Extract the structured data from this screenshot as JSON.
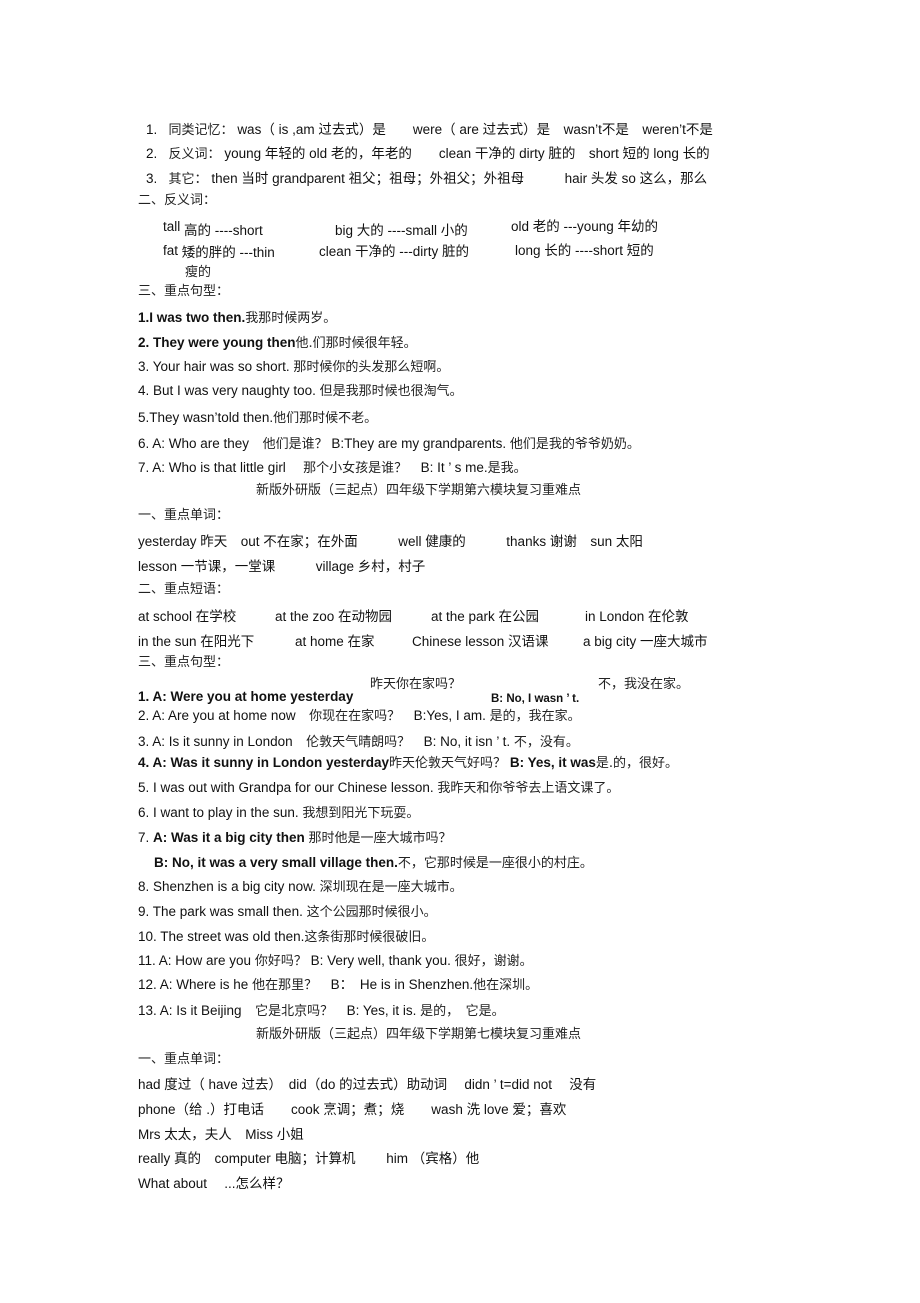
{
  "module5": {
    "memory_lines": [
      {
        "num": "1.",
        "label": "同类记忆：",
        "text": "was（ is ,am 过去式）是　　were（ are 过去式）是　wasn’t不是　weren’t不是"
      },
      {
        "num": "2.",
        "label": "反义词：",
        "text": "young 年轻的  old 老的，年老的　　clean 干净的  dirty 脏的　short 短的 long 长的"
      },
      {
        "num": "3.",
        "label": "其它：",
        "text": "then 当时  grandparent 祖父；祖母；外祖父；外祖母　　　hair 头发  so 这么，那么"
      }
    ],
    "antonyms_heading": "二、反义词：",
    "antonyms": [
      {
        "word": "tall",
        "rest": "高的 ----short"
      },
      {
        "word": "big",
        "rest": "大的 ----small  小的"
      },
      {
        "word": "old",
        "rest": "老的 ---young 年幼的"
      },
      {
        "word": "fat",
        "rest": "矮的胖的 ---thin"
      },
      {
        "word": "clean",
        "rest": "干净的 ---dirty  脏的"
      },
      {
        "word": "long",
        "rest": "长的 ----short 短的"
      },
      {
        "word": "",
        "rest": "瘦的"
      }
    ],
    "sentences_heading": "三、重点句型：",
    "sentences": [
      {
        "en": "1.I was two then.",
        "cn": "我那时候两岁。",
        "bold": true
      },
      {
        "en": "2. They were young then",
        "cn": "他.们那时候很年轻。",
        "bold": true
      },
      {
        "en": "3. Your hair was so short. ",
        "cn": "那时候你的头发那么短啊。",
        "bold": false
      },
      {
        "en": "4. But I was very naughty too. ",
        "cn": "但是我那时候也很淘气。",
        "bold": false
      },
      {
        "en": "5.They wasn’told then.",
        "cn": "他们那时候不老。",
        "bold": false
      },
      {
        "en": "6. A: Who are they　",
        "cn": "他们是谁？",
        "en2": " B:They are my grandparents. ",
        "cn2": "他们是我的爷爷奶奶。",
        "bold": false
      },
      {
        "en": "7. A: Who is that little girl　 ",
        "cn": "那个小女孩是谁？",
        "en2": "　B: It ’ s me.",
        "cn2": "是我。",
        "bold": false
      }
    ]
  },
  "module6": {
    "title": "新版外研版（三起点）四年级下学期第六模块复习重难点",
    "words_heading": "一、重点单词：",
    "word_lines": [
      "yesterday 昨天　out 不在家；在外面　　　well 健康的　　　thanks 谢谢　sun 太阳",
      "lesson 一节课，一堂课　　　village 乡村，村子"
    ],
    "phrases_heading": "二、重点短语：",
    "phrase_lines": [
      [
        "at school 在学校",
        "at the zoo 在动物园",
        "at the park 在公园",
        "in London 在伦敦"
      ],
      [
        "in the sun 在阳光下",
        "at home 在家",
        "Chinese lesson 汉语课",
        "a big city 一座大城市"
      ]
    ],
    "sentences_heading": "三、重点句型：",
    "s1": {
      "en": "1. A: Were you at home yesterday",
      "cn": "昨天你在家吗？",
      "b_en": "B: No, I wasn ’ t.",
      "b_cn": "不，我没在家。"
    },
    "s2": {
      "en": "2. A: Are you at home now　",
      "cn": "你现在在家吗？",
      "en2": "　B:Yes, I am. ",
      "cn2": "是的，我在家。"
    },
    "s3": {
      "en": "3. A: Is it sunny in London　",
      "cn": "伦敦天气晴朗吗？",
      "en2": "　B: No, it isn ’ t. ",
      "cn2": "不，没有。"
    },
    "s4": {
      "en": "4. A: Was it sunny in London yesterday",
      "cn": "昨天伦敦天气好吗？",
      "en2": " B: Yes, it was",
      "cn2": "是.的，很好。"
    },
    "s5": {
      "en": "5. I was out with Grandpa for our Chinese lesson. ",
      "cn": "我昨天和你爷爷去上语文课了。"
    },
    "s6": {
      "en": "6. I want to play in the sun. ",
      "cn": "我想到阳光下玩耍。"
    },
    "s7a": {
      "num": "7. ",
      "en": "A: Was it a big city then ",
      "cn": "那时他是一座大城市吗？"
    },
    "s7b": {
      "en": "B: No, it was a very small village then.",
      "cn": "不，它那时候是一座很小的村庄。"
    },
    "s8": {
      "en": "8. Shenzhen is a big city now. ",
      "cn": "深圳现在是一座大城市。"
    },
    "s9": {
      "en": "9. The park was small then. ",
      "cn": "这个公园那时候很小。"
    },
    "s10": {
      "en": "10. The street was old then.",
      "cn": "这条街那时候很破旧。"
    },
    "s11": {
      "en": "11. A: How are you  ",
      "cn": "你好吗？",
      "en2": " B: Very well, thank you. ",
      "cn2": "很好，谢谢。"
    },
    "s12": {
      "en": "12. A: Where is he  ",
      "cn": "他在那里？",
      "en2": "　B：　He is in Shenzhen.",
      "cn2": "他在深圳。"
    },
    "s13": {
      "en": "13. A: Is it Beijing　",
      "cn": "它是北京吗？",
      "en2": "　B: Yes, it is. ",
      "cn2": "是的，　它是。"
    }
  },
  "module7": {
    "title": "新版外研版（三起点）四年级下学期第七模块复习重难点",
    "words_heading": "一、重点单词：",
    "word_lines": [
      "had 度过（ have 过去）　did（do 的过去式）助动词　 didn ’ t=did not　 没有",
      "phone（给  .）打电话　　cook 烹调；煮；烧　　wash 洗  love 爱；喜欢",
      "Mrs  太太，夫人　Miss 小姐",
      "really 真的　computer 电脑；计算机　　 him （宾格）他",
      "What about　 ...怎么样？"
    ]
  }
}
